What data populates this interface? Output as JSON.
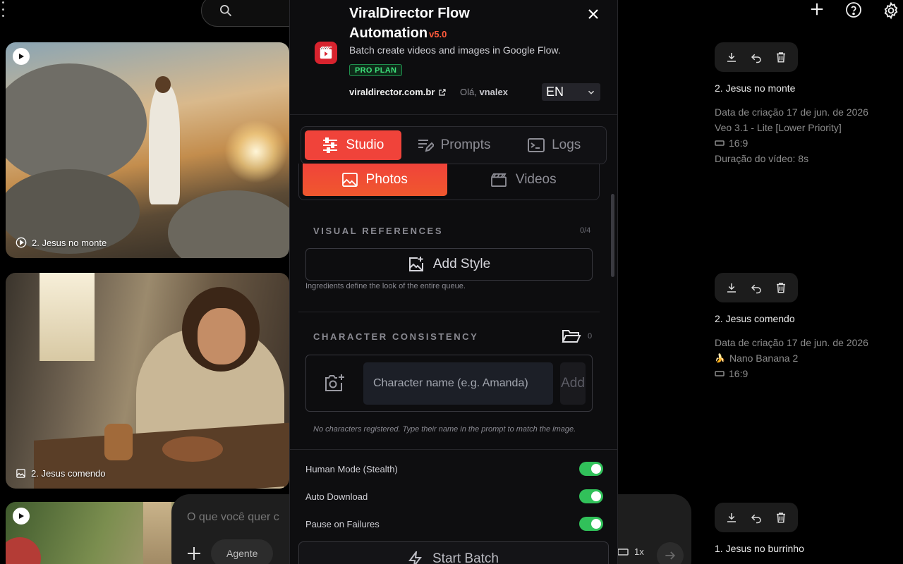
{
  "background": {
    "prompt_placeholder": "O que você quer c",
    "agent_label": "Agente",
    "multiplier": "1x"
  },
  "cards": [
    {
      "caption": "2. Jesus no monte",
      "media": "video"
    },
    {
      "caption": "2. Jesus comendo",
      "media": "image"
    },
    {
      "caption": "",
      "media": "video"
    }
  ],
  "meta": [
    {
      "title": "2. Jesus no monte",
      "lines": [
        "Data de criação 17 de jun. de 2026",
        "Veo 3.1 - Lite [Lower Priority]",
        "16:9",
        "Duração do vídeo: 8s"
      ]
    },
    {
      "title": "2. Jesus comendo",
      "lines": [
        "Data de criação 17 de jun. de 2026",
        "Nano Banana 2",
        "16:9"
      ]
    },
    {
      "title": "1. Jesus no burrinho",
      "lines": []
    }
  ],
  "panel": {
    "title": "ViralDirector Flow Automation",
    "version": "v5.0",
    "subtitle": "Batch create videos and images in Google Flow.",
    "plan_badge": "PRO PLAN",
    "site_link": "viraldirector.com.br",
    "greeting_prefix": "Olá,",
    "username": "vnalex",
    "language": "EN",
    "tabs": [
      {
        "label": "Studio",
        "icon": "sliders-icon"
      },
      {
        "label": "Prompts",
        "icon": "edit-list-icon"
      },
      {
        "label": "Logs",
        "icon": "terminal-icon"
      }
    ],
    "sub_tabs": [
      {
        "label": "Photos",
        "icon": "image-icon"
      },
      {
        "label": "Videos",
        "icon": "clapper-icon"
      }
    ],
    "visual_refs": {
      "label": "VISUAL REFERENCES",
      "count": "0/4",
      "add_label": "Add Style",
      "hint": "Ingredients define the look of the entire queue."
    },
    "characters": {
      "label": "CHARACTER CONSISTENCY",
      "count": "0",
      "placeholder": "Character name (e.g. Amanda)",
      "add_label": "Add",
      "empty_text": "No characters registered. Type their name in the prompt to match the image."
    },
    "toggles": [
      {
        "label": "Human Mode (Stealth)",
        "on": true
      },
      {
        "label": "Auto Download",
        "on": true
      },
      {
        "label": "Pause on Failures",
        "on": true
      }
    ],
    "start_label": "Start Batch"
  },
  "colors": {
    "accent": "#f0433a",
    "toggle_on": "#31c15a",
    "pro_badge": "#3ee07a",
    "version": "#ff5a3c"
  }
}
